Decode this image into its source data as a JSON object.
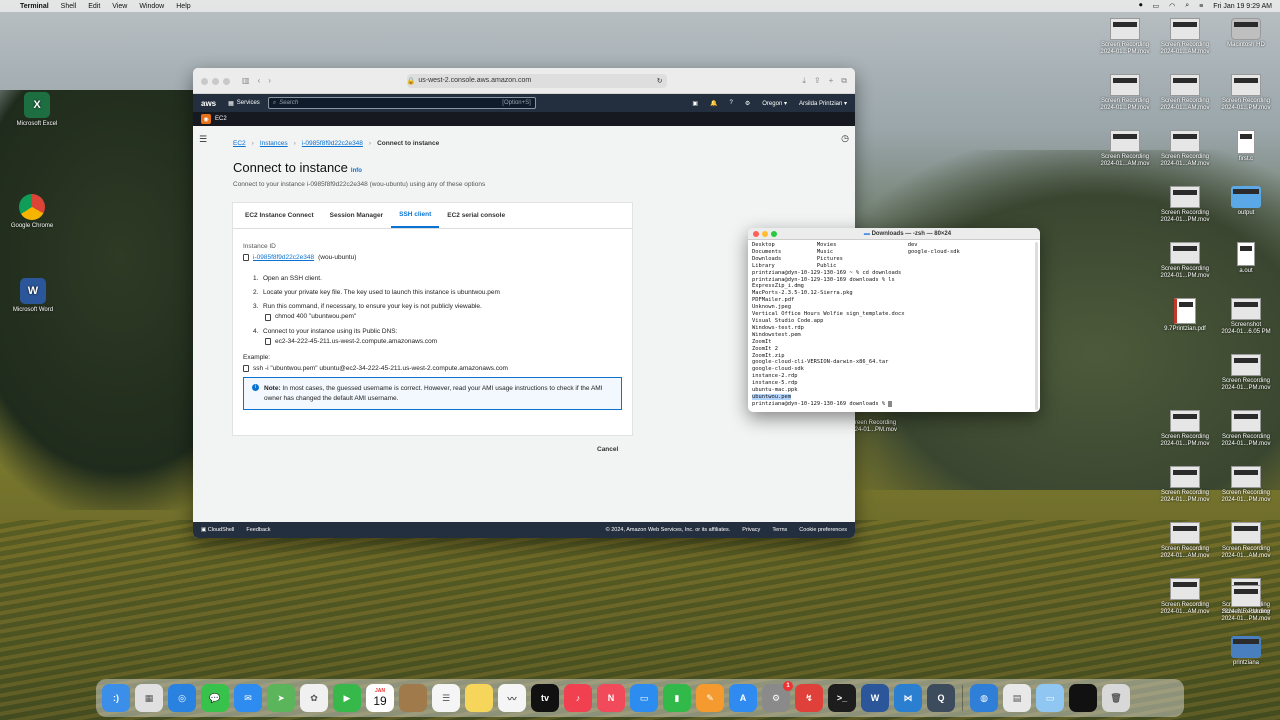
{
  "menubar": {
    "apple": "",
    "app": "Terminal",
    "items": [
      "Shell",
      "Edit",
      "View",
      "Window",
      "Help"
    ],
    "clock": "Fri Jan 19  9:29 AM"
  },
  "desktop": {
    "left_icons": [
      {
        "label": "Microsoft Excel",
        "letter": "X",
        "color": "#1d6f42"
      },
      {
        "label": "Google Chrome",
        "letter": "●",
        "color": "#e0e0e0"
      },
      {
        "label": "Microsoft Word",
        "letter": "W",
        "color": "#2b579a"
      }
    ],
    "right_icons": [
      {
        "label": "Screen Recording\n2024-01...PM.mov"
      },
      {
        "label": "Screen Recording\n2024-01...AM.mov"
      },
      {
        "label": "Macintosh HD"
      },
      {
        "label": "Screen Recording\n2024-01...PM.mov"
      },
      {
        "label": "Screen Recording\n2024-01...AM.mov"
      },
      {
        "label": "Screen Recording\n2024-01...PM.mov"
      },
      {
        "label": "Screen Recording\n2024-01...AM.mov"
      },
      {
        "label": "Screen Recording\n2024-01...AM.mov"
      },
      {
        "label": "first.c"
      },
      {
        "label": "Screen Recording\n2024-01...PM.mov"
      },
      {
        "label": "output"
      },
      {
        "label": "Screen Recording\n2024-01...PM.mov"
      },
      {
        "label": "a.out"
      },
      {
        "label": "9.7Printzian.pdf"
      },
      {
        "label": "Screenshot\n2024-01...6.05 PM"
      },
      {
        "label": "Screen Recording\n2024-01...PM.mov"
      },
      {
        "label": "Screen Recording\n2024-01...PM.mov"
      },
      {
        "label": "Screen Recording\n2024-01...PM.mov"
      },
      {
        "label": "Screen Recording\n2024-01...PM.mov"
      },
      {
        "label": "Screen Recording\n2024-01...PM.mov"
      },
      {
        "label": "Screen Recording\n2024-01...AM.mov"
      },
      {
        "label": "Screen Recording\n2024-01...AM.mov"
      },
      {
        "label": "Screen Recording\n2024-01...AM.mov"
      },
      {
        "label": "Screen Recording\n2024-01...PM.mov"
      },
      {
        "label": "Screen Recording\n2024-01...PM.mov"
      },
      {
        "label": "printziana"
      }
    ],
    "behind_terminal_label": "Screen Recording\n2024-01...PM.mov"
  },
  "browser": {
    "url": "us-west-2.console.aws.amazon.com",
    "aws": {
      "logo": "aws",
      "services": "Services",
      "search_placeholder": "Search",
      "search_hint": "[Option+S]",
      "region": "Oregon ▾",
      "user": "Arsilda Printzian ▾",
      "sub_service": "EC2"
    },
    "breadcrumb": [
      "EC2",
      "Instances",
      "i-0985f8f9d22c2e348",
      "Connect to instance"
    ],
    "title": "Connect to instance",
    "info": "Info",
    "subtitle": "Connect to your instance i-0985f8f9d22c2e348 (wou-ubuntu) using any of these options",
    "tabs": [
      "EC2 Instance Connect",
      "Session Manager",
      "SSH client",
      "EC2 serial console"
    ],
    "active_tab": "SSH client",
    "instance_id_label": "Instance ID",
    "instance_id": "i-0985f8f9d22c2e348",
    "instance_name": "(wou-ubuntu)",
    "steps": [
      "Open an SSH client.",
      "Locate your private key file. The key used to launch this instance is ubuntwou.pem",
      "Run this command, if necessary, to ensure your key is not publicly viewable.",
      "Connect to your instance using its Public DNS:"
    ],
    "chmod_cmd": "chmod 400 \"ubuntwou.pem\"",
    "public_dns": "ec2-34-222-45-211.us-west-2.compute.amazonaws.com",
    "example_label": "Example:",
    "example_cmd": "ssh -i \"ubuntwou.pem\" ubuntu@ec2-34-222-45-211.us-west-2.compute.amazonaws.com",
    "note_bold": "Note:",
    "note_text": "In most cases, the guessed username is correct. However, read your AMI usage instructions to check if the AMI owner has changed the default AMI username.",
    "cancel": "Cancel",
    "footer": {
      "cloudshell": "CloudShell",
      "feedback": "Feedback",
      "copyright": "© 2024, Amazon Web Services, Inc. or its affiliates.",
      "privacy": "Privacy",
      "terms": "Terms",
      "cookies": "Cookie preferences"
    }
  },
  "terminal": {
    "title": "Downloads — -zsh — 80×24",
    "lines": [
      "Desktop             Movies                      dev",
      "Documents           Music                       google-cloud-sdk",
      "Downloads           Pictures",
      "Library             Public",
      "printziana@dyn-10-129-130-169 ~ % cd downloads",
      "printziana@dyn-10-129-130-169 downloads % ls",
      "ExpressZip_i.dmg",
      "MacPorts-2.3.5-10.12-Sierra.pkg",
      "PDFMailer.pdf",
      "Unknown.jpeg",
      "Vertical Office Hours Wolfie sign_template.docx",
      "Visual Studio Code.app",
      "Windows-test.rdp",
      "Windowstest.pem",
      "ZoomIt",
      "ZoomIt 2",
      "ZoomIt.zip",
      "google-cloud-cli-VERSION-darwin-x86_64.tar",
      "google-cloud-sdk",
      "instance-2.rdp",
      "instance-5.rdp",
      "ubuntu-mac.ppk"
    ],
    "highlight_line": "ubuntwou.pem",
    "prompt": "printziana@dyn-10-129-130-169 downloads % "
  },
  "dock": {
    "calendar_month": "JAN",
    "calendar_day": "19",
    "badge_count": "1",
    "apps": [
      {
        "name": "finder-icon",
        "color": "#3b8fe8",
        "glyph": ":)"
      },
      {
        "name": "launchpad-icon",
        "color": "#e0e0e0",
        "glyph": "▦"
      },
      {
        "name": "safari-icon",
        "color": "#2a82e0",
        "glyph": "◎"
      },
      {
        "name": "messages-icon",
        "color": "#37c24b",
        "glyph": "💬"
      },
      {
        "name": "mail-icon",
        "color": "#2e8cf0",
        "glyph": "✉"
      },
      {
        "name": "maps-icon",
        "color": "#5bb55a",
        "glyph": "➤"
      },
      {
        "name": "photos-icon",
        "color": "#f0f0f0",
        "glyph": "✿"
      },
      {
        "name": "facetime-icon",
        "color": "#36b84a",
        "glyph": "▶"
      },
      {
        "name": "calendar-icon",
        "color": "#ffffff",
        "glyph": ""
      },
      {
        "name": "notes-brown-icon",
        "color": "#a07a4a",
        "glyph": ""
      },
      {
        "name": "reminders-icon",
        "color": "#f5f5f5",
        "glyph": "☰"
      },
      {
        "name": "notes-icon",
        "color": "#f6d65a",
        "glyph": ""
      },
      {
        "name": "freeform-icon",
        "color": "#f5f5f5",
        "glyph": "〰"
      },
      {
        "name": "appletv-icon",
        "color": "#111111",
        "glyph": "tv"
      },
      {
        "name": "music-icon",
        "color": "#f1404f",
        "glyph": "♪"
      },
      {
        "name": "news-icon",
        "color": "#f14a5a",
        "glyph": "N"
      },
      {
        "name": "keynote-icon",
        "color": "#2d8cf0",
        "glyph": "▭"
      },
      {
        "name": "numbers-icon",
        "color": "#31b94a",
        "glyph": "▮"
      },
      {
        "name": "pages-icon",
        "color": "#f59a2f",
        "glyph": "✎"
      },
      {
        "name": "appstore-icon",
        "color": "#2f8bf0",
        "glyph": "A"
      },
      {
        "name": "settings-icon",
        "color": "#8a8a8a",
        "glyph": "⚙"
      },
      {
        "name": "remote-desktop-icon",
        "color": "#e0403a",
        "glyph": "↯"
      },
      {
        "name": "terminal-icon",
        "color": "#1d1d1d",
        "glyph": ">_"
      },
      {
        "name": "word-icon",
        "color": "#2b579a",
        "glyph": "W"
      },
      {
        "name": "vscode-icon",
        "color": "#2a7fd0",
        "glyph": "⋈"
      },
      {
        "name": "quicktime-icon",
        "color": "#3d4c5c",
        "glyph": "Q"
      },
      {
        "name": "network-icon",
        "color": "#2f7fd8",
        "glyph": "◍"
      },
      {
        "name": "preview-icon",
        "color": "#e8e8e8",
        "glyph": "▤"
      },
      {
        "name": "folder-icon",
        "color": "#8fc6f2",
        "glyph": "▭"
      },
      {
        "name": "black-window-icon",
        "color": "#111111",
        "glyph": ""
      },
      {
        "name": "trash-icon",
        "color": "#d8d8d8",
        "glyph": "🗑"
      }
    ]
  }
}
